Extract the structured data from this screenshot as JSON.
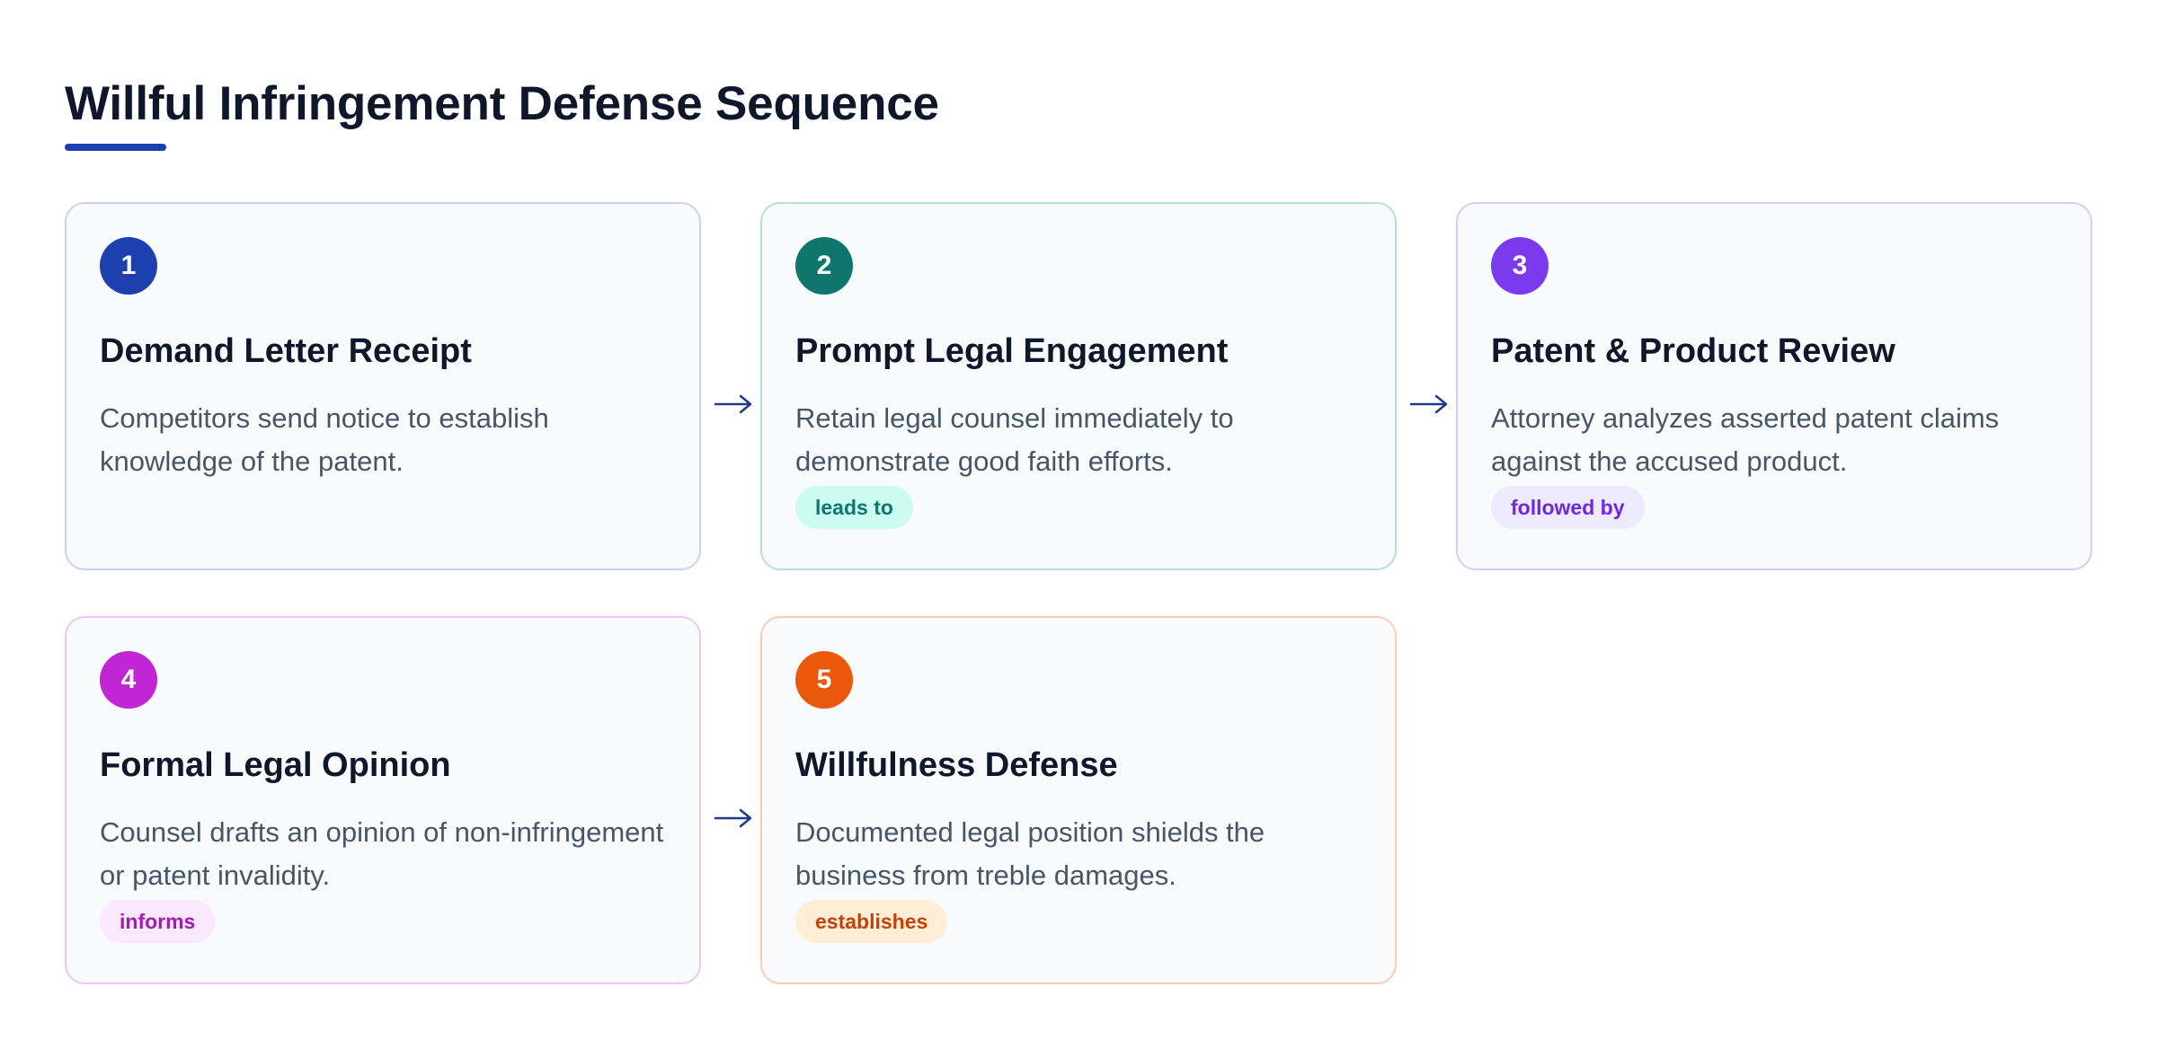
{
  "header": {
    "title": "Willful Infringement Defense Sequence"
  },
  "colors": {
    "title_underline": "#1e40af",
    "connector_arrow": "#1e3a8a"
  },
  "steps": [
    {
      "number": "1",
      "title": "Demand Letter Receipt",
      "description": "Competitors send notice to establish knowledge of the patent.",
      "relation": "",
      "accent": "#1e40af",
      "border": "#c7d2ee"
    },
    {
      "number": "2",
      "title": "Prompt Legal Engagement",
      "description": "Retain legal counsel immediately to demonstrate good faith efforts.",
      "relation": "leads to",
      "accent": "#0f766e",
      "border": "#b9ddd8",
      "tag_bg": "#ccfbf1",
      "tag_text": "#0f766e"
    },
    {
      "number": "3",
      "title": "Patent & Product Review",
      "description": "Attorney analyzes asserted patent claims against the accused product.",
      "relation": "followed by",
      "accent": "#7c3aed",
      "border": "#d6ccf5",
      "tag_bg": "#ede9fe",
      "tag_text": "#6d28d9"
    },
    {
      "number": "4",
      "title": "Formal Legal Opinion",
      "description": "Counsel drafts an opinion of non-infringement or patent invalidity.",
      "relation": "informs",
      "accent": "#c026d3",
      "border": "#efc6f2",
      "tag_bg": "#fae8ff",
      "tag_text": "#a21caf"
    },
    {
      "number": "5",
      "title": "Willfulness Defense",
      "description": "Documented legal position shields the business from treble damages.",
      "relation": "establishes",
      "accent": "#ea580c",
      "border": "#f8cdb4",
      "tag_bg": "#ffedd5",
      "tag_text": "#c2410c"
    }
  ]
}
